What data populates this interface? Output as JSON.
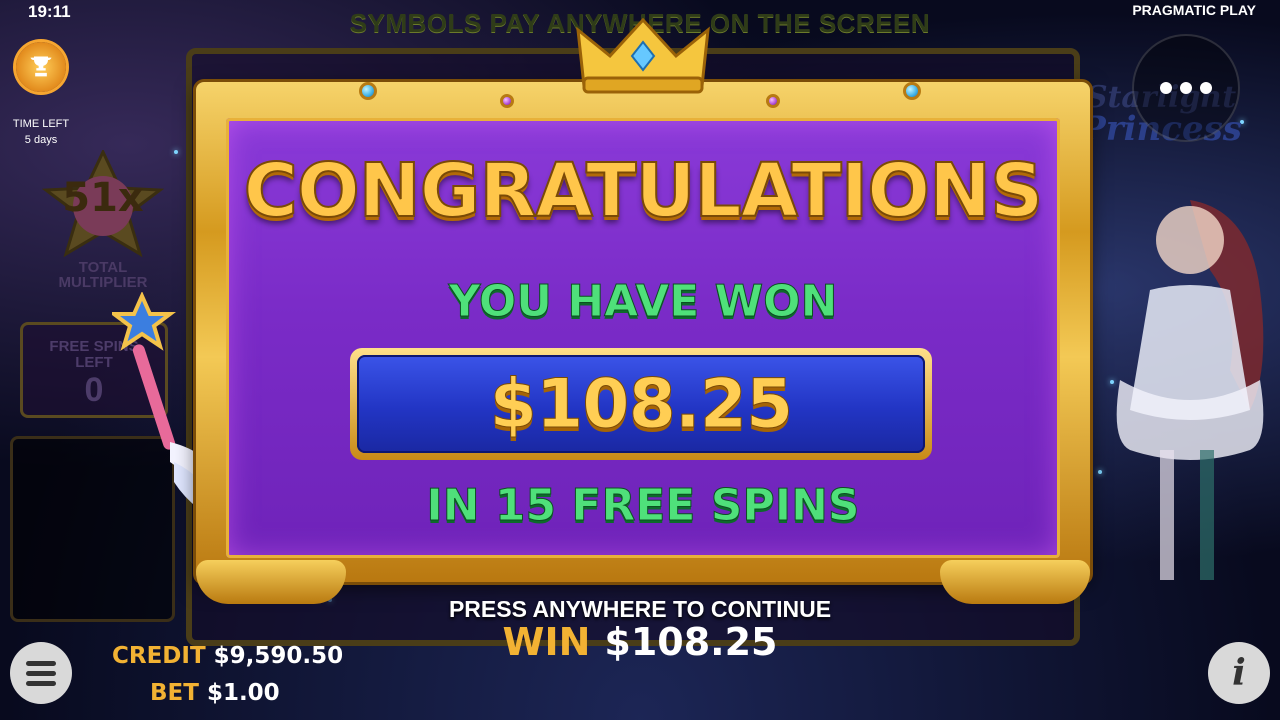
{
  "status_bar": {
    "clock": "19:11",
    "provider": "PRAGMATIC PLAY"
  },
  "banner": "SYMBOLS PAY ANYWHERE ON THE SCREEN",
  "tournament": {
    "icon": "trophy-icon",
    "time_left_label": "TIME LEFT",
    "time_left_value": "5 days"
  },
  "multiplier": {
    "value": "51x",
    "label_line1": "TOTAL",
    "label_line2": "MULTIPLIER"
  },
  "free_spins": {
    "label_line1": "FREE SPINS",
    "label_line2": "LEFT",
    "value": "0"
  },
  "game_logo": {
    "line1": "Starlight",
    "line2": "Princess"
  },
  "modal": {
    "title": "CONGRATULATIONS",
    "subtitle": "YOU HAVE WON",
    "amount": "$108.25",
    "spins_text": "IN 15 FREE SPINS"
  },
  "continue_prompt": "PRESS ANYWHERE TO CONTINUE",
  "win": {
    "label": "WIN",
    "value": "$108.25"
  },
  "hud": {
    "credit_label": "CREDIT",
    "credit_value": "$9,590.50",
    "bet_label": "BET",
    "bet_value": "$1.00",
    "info_glyph": "i"
  },
  "colors": {
    "gold": "#f2b233",
    "modal_purple": "#7a2bc7",
    "amount_blue": "#2235c4",
    "green_text": "#4fe07a"
  }
}
